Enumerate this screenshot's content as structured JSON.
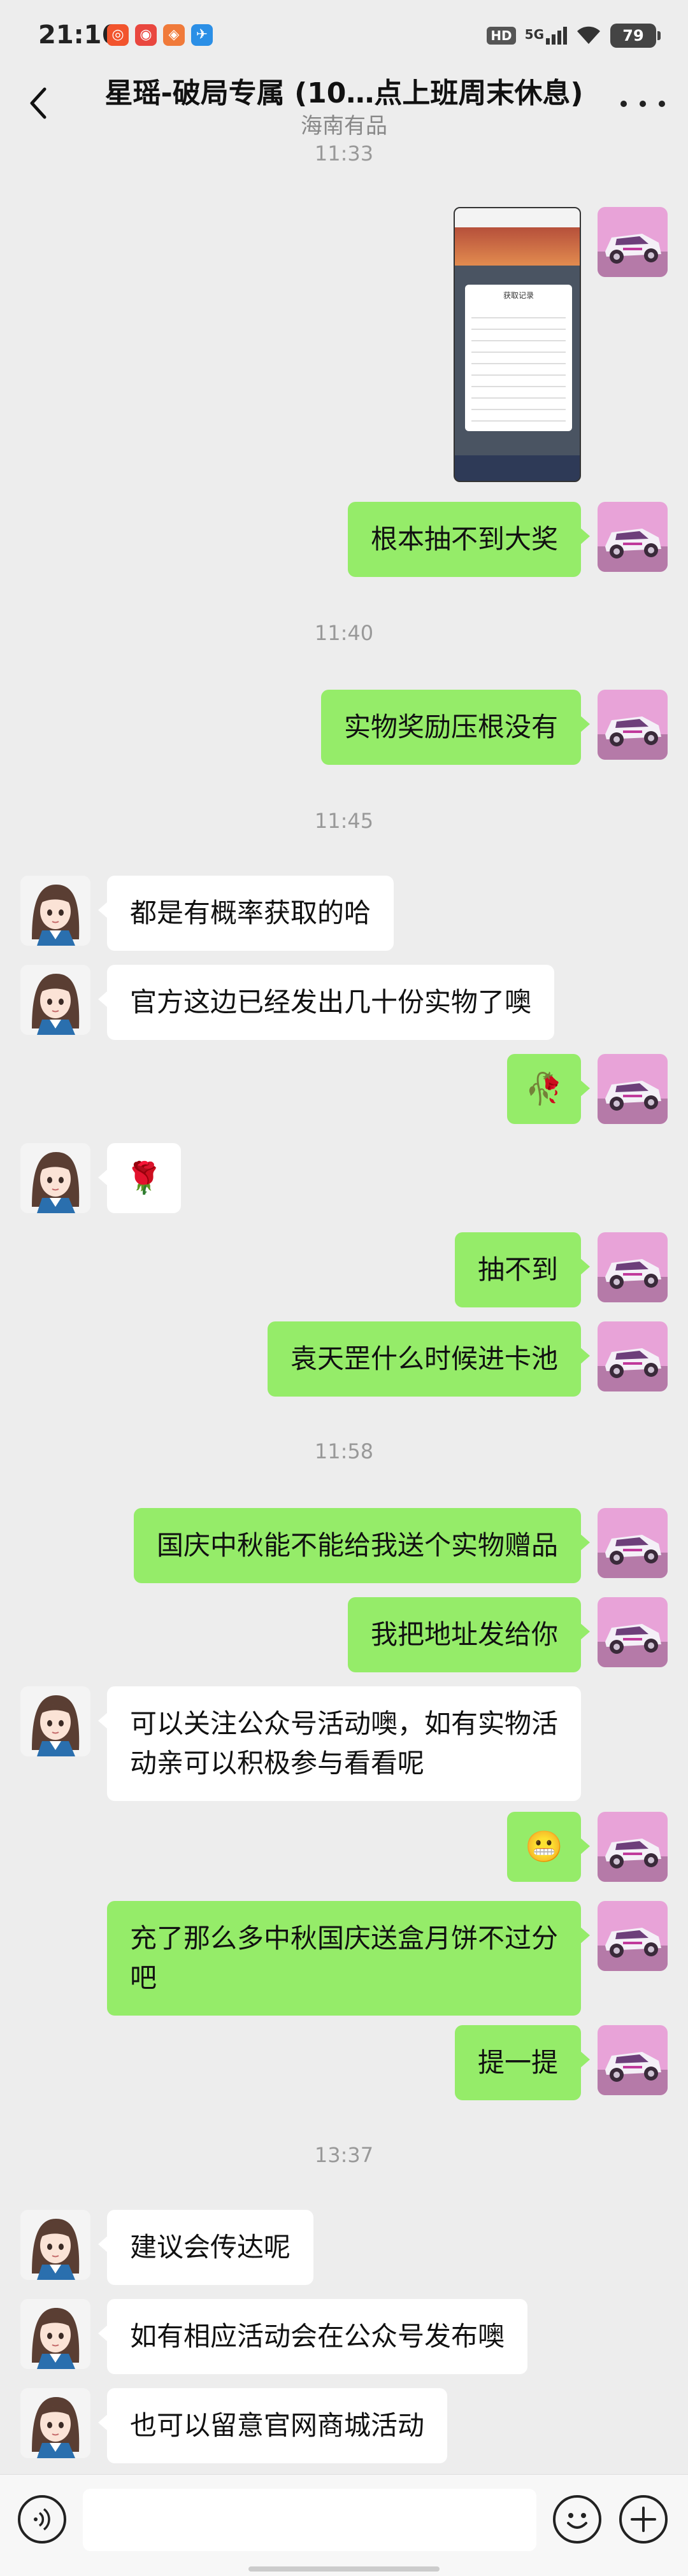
{
  "status_bar": {
    "time": "21:16",
    "signal_label": "5G",
    "hd_label": "HD",
    "battery": "79"
  },
  "header": {
    "title": "星瑶-破局专属 (10…点上班周末休息)",
    "subtitle": "海南有品"
  },
  "timestamps": {
    "t1": "11:33",
    "t2": "11:40",
    "t3": "11:45",
    "t4": "11:58",
    "t5": "13:37"
  },
  "messages": {
    "m1": "根本抽不到大奖",
    "m2": "实物奖励压根没有",
    "m3": "都是有概率获取的哈",
    "m4": "官方这边已经发出几十份实物了噢",
    "m5": "🥀",
    "m6": "🌹",
    "m7": "抽不到",
    "m8": "袁天罡什么时候进卡池",
    "m9": "国庆中秋能不能给我送个实物赠品",
    "m10": "我把地址发给你",
    "m11": "可以关注公众号活动噢，如有实物活动亲可以积极参与看看呢",
    "m12": "😬",
    "m13": "充了那么多中秋国庆送盒月饼不过分吧",
    "m14": "提一提",
    "m15": "建议会传达呢",
    "m16": "如有相应活动会在公众号发布噢",
    "m17": "也可以留意官网商城活动"
  },
  "image_message": {
    "dialog_title": "获取记录"
  },
  "colors": {
    "sent_bubble": "#95ec69",
    "recv_bubble": "#ffffff",
    "background": "#ededed"
  }
}
